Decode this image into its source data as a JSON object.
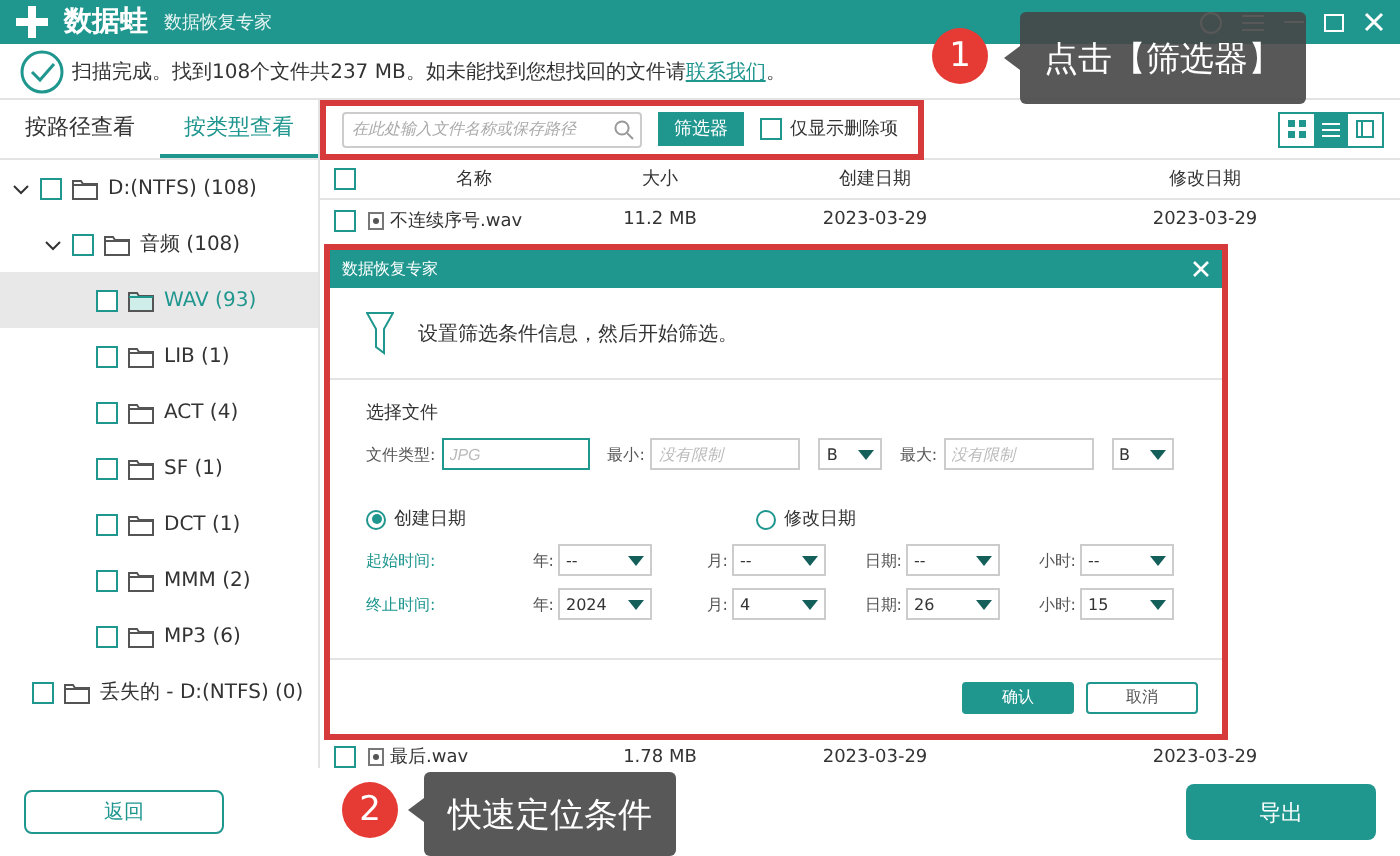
{
  "window": {
    "logo_text": "数据蛙",
    "title": "数据恢复专家"
  },
  "status": {
    "text": "扫描完成。找到108个文件共237 MB。如未能找到您想找回的文件请",
    "link": "联系我们",
    "end": "。"
  },
  "view_tabs": [
    {
      "label": "按路径查看",
      "selected": false
    },
    {
      "label": "按类型查看",
      "selected": true
    }
  ],
  "tree": [
    {
      "label": "D:(NTFS) (108)",
      "expanded": true,
      "checked": false,
      "selected": false,
      "children": [
        {
          "label": "音频 (108)",
          "expanded": true,
          "checked": false,
          "selected": false,
          "children": [
            {
              "label": "WAV (93)",
              "checked": false,
              "selected": true
            },
            {
              "label": "LIB (1)",
              "checked": false,
              "selected": false
            },
            {
              "label": "ACT (4)",
              "checked": false,
              "selected": false
            },
            {
              "label": "SF (1)",
              "checked": false,
              "selected": false
            },
            {
              "label": "DCT (1)",
              "checked": false,
              "selected": false
            },
            {
              "label": "MMM (2)",
              "checked": false,
              "selected": false
            },
            {
              "label": "MP3 (6)",
              "checked": false,
              "selected": false
            }
          ]
        }
      ]
    },
    {
      "label": "丢失的 - D:(NTFS) (0)",
      "checked": false,
      "selected": false
    }
  ],
  "toolbar": {
    "search": {
      "placeholder": "在此处输入文件名称或保存路径"
    },
    "filter_button": "筛选器",
    "deleted_only": {
      "label": "仅显示删除项",
      "checked": false
    },
    "view_modes": [
      {
        "kind": "grid",
        "selected": false
      },
      {
        "kind": "list",
        "selected": true
      },
      {
        "kind": "detail",
        "selected": false
      }
    ]
  },
  "table": {
    "select_all": {
      "checked": false
    },
    "columns": [
      "名称",
      "大小",
      "创建日期",
      "修改日期"
    ],
    "rows": [
      {
        "name": "不连续序号.wav",
        "size": "11.2 MB",
        "created": "2023-03-29",
        "modified": "2023-03-29",
        "checked": false
      },
      {
        "name": "最后.wav",
        "size": "1.78 MB",
        "created": "2023-03-29",
        "modified": "2023-03-29",
        "checked": false
      }
    ]
  },
  "dialog": {
    "title": "数据恢复专家",
    "heading": "设置筛选条件信息，然后开始筛选。",
    "section": "选择文件",
    "file_type": {
      "label": "文件类型:",
      "placeholder": "JPG"
    },
    "min": {
      "label": "最小:",
      "placeholder": "没有限制",
      "unit": "B"
    },
    "max": {
      "label": "最大:",
      "placeholder": "没有限制",
      "unit": "B"
    },
    "date_modes": [
      {
        "label": "创建日期",
        "selected": true
      },
      {
        "label": "修改日期",
        "selected": false
      }
    ],
    "ranges": [
      {
        "label": "起始时间:",
        "fields": [
          {
            "label": "年:",
            "value": "--"
          },
          {
            "label": "月:",
            "value": "--"
          },
          {
            "label": "日期:",
            "value": "--"
          },
          {
            "label": "小时:",
            "value": "--"
          }
        ]
      },
      {
        "label": "终止时间:",
        "fields": [
          {
            "label": "年:",
            "value": "2024"
          },
          {
            "label": "月:",
            "value": "4"
          },
          {
            "label": "日期:",
            "value": "26"
          },
          {
            "label": "小时:",
            "value": "15"
          }
        ]
      }
    ],
    "buttons": [
      {
        "label": "确认",
        "kind": "primary"
      },
      {
        "label": "取消",
        "kind": "secondary"
      }
    ]
  },
  "footer": {
    "back": "返回",
    "export": "导出"
  },
  "callouts": [
    {
      "number": "1",
      "text": "点击【筛选器】"
    },
    {
      "number": "2",
      "text": "快速定位条件"
    }
  ]
}
